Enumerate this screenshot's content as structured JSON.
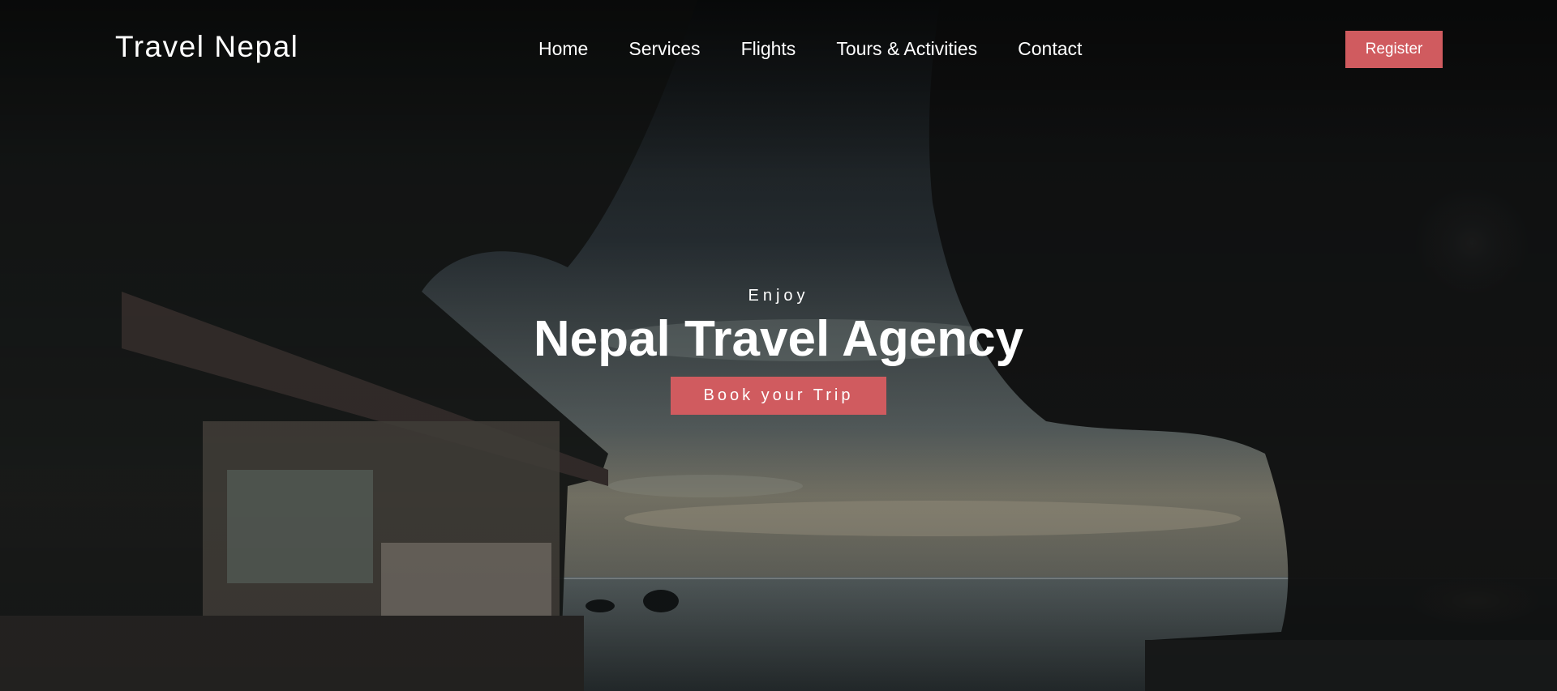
{
  "header": {
    "brand": "Travel Nepal",
    "nav": [
      {
        "label": "Home"
      },
      {
        "label": "Services"
      },
      {
        "label": "Flights"
      },
      {
        "label": "Tours & Activities"
      },
      {
        "label": "Contact"
      }
    ],
    "register_label": "Register"
  },
  "hero": {
    "kicker": "Enjoy",
    "title": "Nepal Travel Agency",
    "cta_label": "Book your Trip"
  },
  "colors": {
    "accent": "#d05b5f",
    "text": "#ffffff"
  }
}
